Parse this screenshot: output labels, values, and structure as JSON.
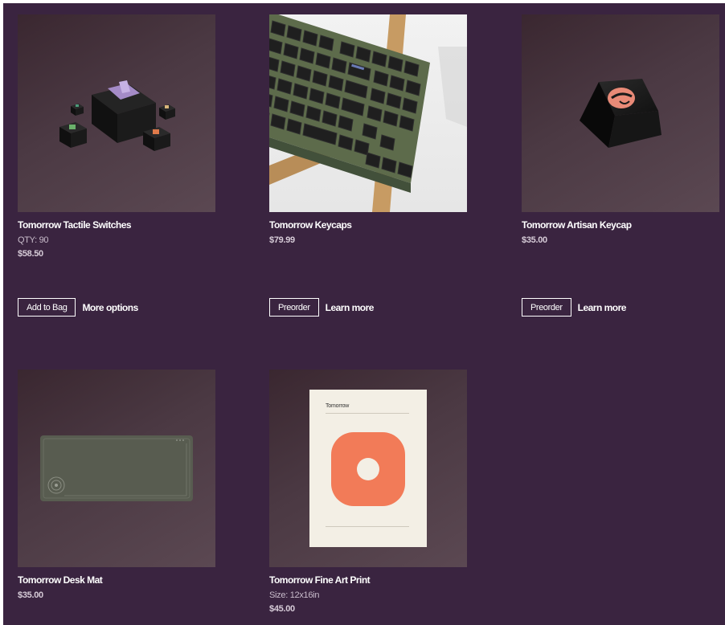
{
  "products": [
    {
      "title": "Tomorrow Tactile Switches",
      "qty": "QTY: 90",
      "price": "$58.50",
      "primary_button": "Add to Bag",
      "secondary_link": "More options",
      "image": "mechanical-switches-image"
    },
    {
      "title": "Tomorrow Keycaps",
      "price": "$79.99",
      "primary_button": "Preorder",
      "secondary_link": "Learn more",
      "image": "keyboard-keycaps-image"
    },
    {
      "title": "Tomorrow Artisan Keycap",
      "price": "$35.00",
      "primary_button": "Preorder",
      "secondary_link": "Learn more",
      "image": "artisan-keycap-image"
    },
    {
      "title": "Tomorrow Desk Mat",
      "price": "$35.00",
      "image": "desk-mat-image"
    },
    {
      "title": "Tomorrow Fine Art Print",
      "size": "Size: 12x16in",
      "price": "$45.00",
      "image": "art-print-image",
      "print_label": "Tomorrow"
    }
  ]
}
